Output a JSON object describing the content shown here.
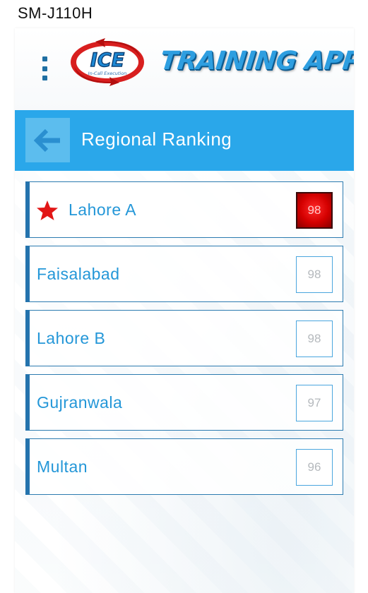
{
  "status_bar": {
    "device": "SM-J110H"
  },
  "header": {
    "logo_text": "ICE",
    "logo_subtext": "In-Call Execution",
    "app_title": "TRAINING APP"
  },
  "title_bar": {
    "title": "Regional Ranking"
  },
  "ranking": [
    {
      "name": "Lahore A",
      "score": "98",
      "highlighted": true
    },
    {
      "name": "Faisalabad",
      "score": "98",
      "highlighted": false
    },
    {
      "name": "Lahore B",
      "score": "98",
      "highlighted": false
    },
    {
      "name": "Gujranwala",
      "score": "97",
      "highlighted": false
    },
    {
      "name": "Multan",
      "score": "96",
      "highlighted": false
    }
  ],
  "colors": {
    "title_bar": "#2aa7ea",
    "accent_blue": "#2497d8",
    "row_border": "#2473ad",
    "top_score_red": "#d40000"
  },
  "icons": {
    "menu": "vertical-dots-icon",
    "back": "arrow-left-icon",
    "top_rank": "star-icon"
  }
}
